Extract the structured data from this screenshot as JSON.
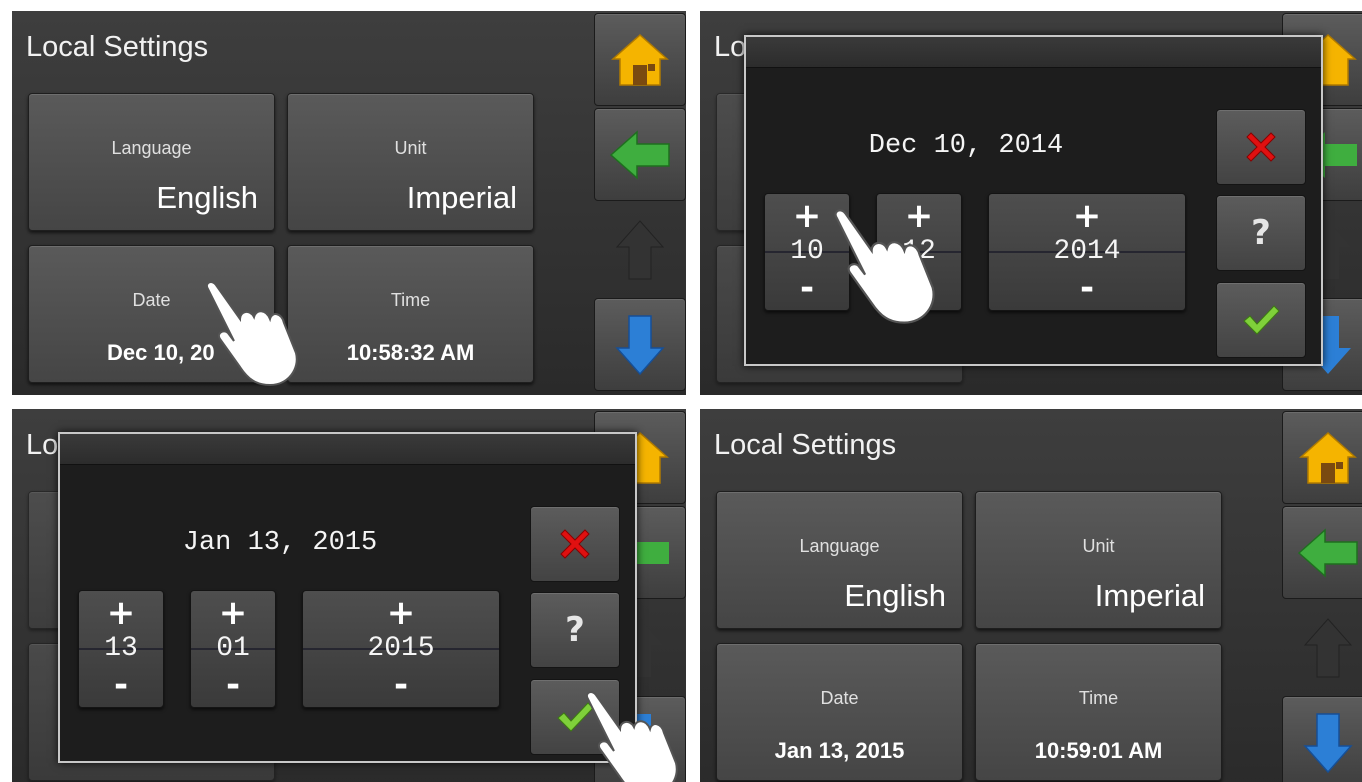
{
  "screens": [
    {
      "title": "Local Settings",
      "tiles": {
        "language": {
          "label": "Language",
          "value": "English"
        },
        "unit": {
          "label": "Unit",
          "value": "Imperial"
        },
        "date": {
          "label": "Date",
          "value": "Dec 10, 20"
        },
        "time": {
          "label": "Time",
          "value": "10:58:32 AM"
        }
      }
    },
    {
      "title_partial": "Lo",
      "dialog": {
        "date": "Dec 10, 2014",
        "day": "10",
        "month": "12",
        "year": "2014",
        "plus": "+",
        "minus": "-",
        "help": "?"
      }
    },
    {
      "title_partial": "Lo",
      "dialog": {
        "date": "Jan 13, 2015",
        "day": "13",
        "month": "01",
        "year": "2015",
        "plus": "+",
        "minus": "-",
        "help": "?"
      }
    },
    {
      "title": "Local Settings",
      "tiles": {
        "language": {
          "label": "Language",
          "value": "English"
        },
        "unit": {
          "label": "Unit",
          "value": "Imperial"
        },
        "date": {
          "label": "Date",
          "value": "Jan 13, 2015"
        },
        "time": {
          "label": "Time",
          "value": "10:59:01 AM"
        }
      }
    }
  ],
  "icons": {
    "home": "home-icon",
    "back": "back-arrow-icon",
    "up": "up-arrow-icon",
    "down": "down-arrow-icon",
    "cancel": "cancel-x-icon",
    "confirm": "check-icon",
    "pointer": "hand-pointer-icon"
  },
  "colors": {
    "home_icon": "#f5b400",
    "back_arrow": "#3fae3f",
    "down_arrow": "#2c7fd6",
    "up_arrow": "#333333",
    "cancel": "#e01010",
    "confirm": "#7fd03a"
  }
}
